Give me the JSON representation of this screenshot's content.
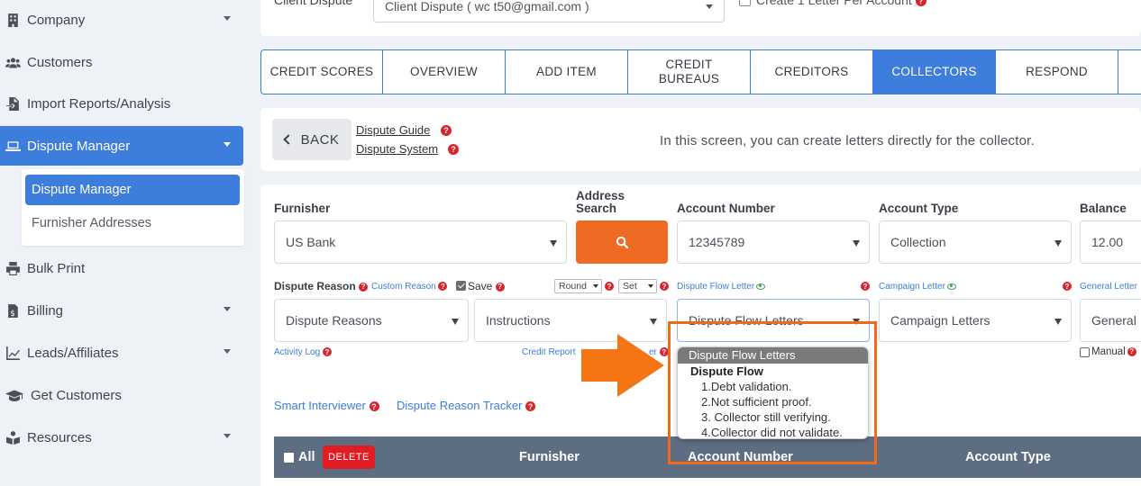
{
  "sidebar": {
    "items": [
      {
        "label": "Company",
        "icon": "building-icon",
        "has_caret": true
      },
      {
        "label": "Customers",
        "icon": "users-icon",
        "has_caret": false
      },
      {
        "label": "Import Reports/Analysis",
        "icon": "file-import-icon",
        "has_caret": false
      },
      {
        "label": "Dispute Manager",
        "icon": "laptop-icon",
        "has_caret": true,
        "active": true
      },
      {
        "label": "Bulk Print",
        "icon": "printer-icon",
        "has_caret": false
      },
      {
        "label": "Billing",
        "icon": "invoice-icon",
        "has_caret": true
      },
      {
        "label": "Leads/Affiliates",
        "icon": "chart-line-icon",
        "has_caret": true
      },
      {
        "label": "Get Customers",
        "icon": "graduation-cap-icon",
        "has_caret": false
      },
      {
        "label": "Resources",
        "icon": "book-reader-icon",
        "has_caret": true
      }
    ],
    "submenu": [
      {
        "label": "Dispute Manager",
        "active": true
      },
      {
        "label": "Furnisher Addresses",
        "active": false
      }
    ]
  },
  "topbar": {
    "label": "Client Dispute",
    "select_value": "Client Dispute ( wc        t50@gmail.com )",
    "checkbox_label": "Create 1 Letter Per Account"
  },
  "tabs": [
    {
      "label": "CREDIT SCORES"
    },
    {
      "label": "OVERVIEW"
    },
    {
      "label": "ADD ITEM"
    },
    {
      "label": "CREDIT BUREAUS"
    },
    {
      "label": "CREDITORS"
    },
    {
      "label": "COLLECTORS",
      "active": true
    },
    {
      "label": "RESPOND"
    },
    {
      "label": ""
    }
  ],
  "back": {
    "label": "BACK",
    "guide_link": "Dispute Guide",
    "system_link": "Dispute System",
    "info": "In this screen, you can create letters directly for the collector."
  },
  "form": {
    "furnisher_label": "Furnisher",
    "furnisher_value": "US Bank",
    "address_search_label": "Address Search",
    "account_number_label": "Account Number",
    "account_number_value": "12345789",
    "account_type_label": "Account Type",
    "account_type_value": "Collection",
    "balance_label": "Balance",
    "balance_value": "12.00",
    "dispute_reason_label": "Dispute Reason",
    "custom_reason_label": "Custom Reason",
    "save_label": "Save",
    "round_value": "Round",
    "set_value": "Set",
    "dispute_flow_letter_label": "Dispute Flow Letter",
    "campaign_letter_label": "Campaign Letter",
    "general_letter_label": "General Letter",
    "dispute_reasons_value": "Dispute Reasons",
    "instructions_value": "Instructions",
    "dispute_flow_value": "Dispute Flow Letters",
    "campaign_letters_value": "Campaign Letters",
    "general_value": "General",
    "activity_log_label": "Activity Log",
    "credit_report_label": "Credit Report",
    "partial_label": "er",
    "manual_label": "Manual",
    "smart_interviewer_label": "Smart Interviewer",
    "dispute_reason_tracker_label": "Dispute Reason Tracker"
  },
  "dropdown": {
    "header": "Dispute Flow Letters",
    "group": "Dispute Flow",
    "options": [
      "1.Debt validation.",
      "2.Not sufficient proof.",
      "3. Collector still verifying.",
      "4.Collector did not validate."
    ]
  },
  "table": {
    "all_label": "All",
    "delete_label": "DELETE",
    "columns": [
      "Furnisher",
      "Account Number",
      "Account Type"
    ]
  },
  "colors": {
    "accent": "#3d7ddb",
    "orange": "#ee6a23",
    "danger": "#e31b23",
    "table_header": "#5e6e82"
  }
}
